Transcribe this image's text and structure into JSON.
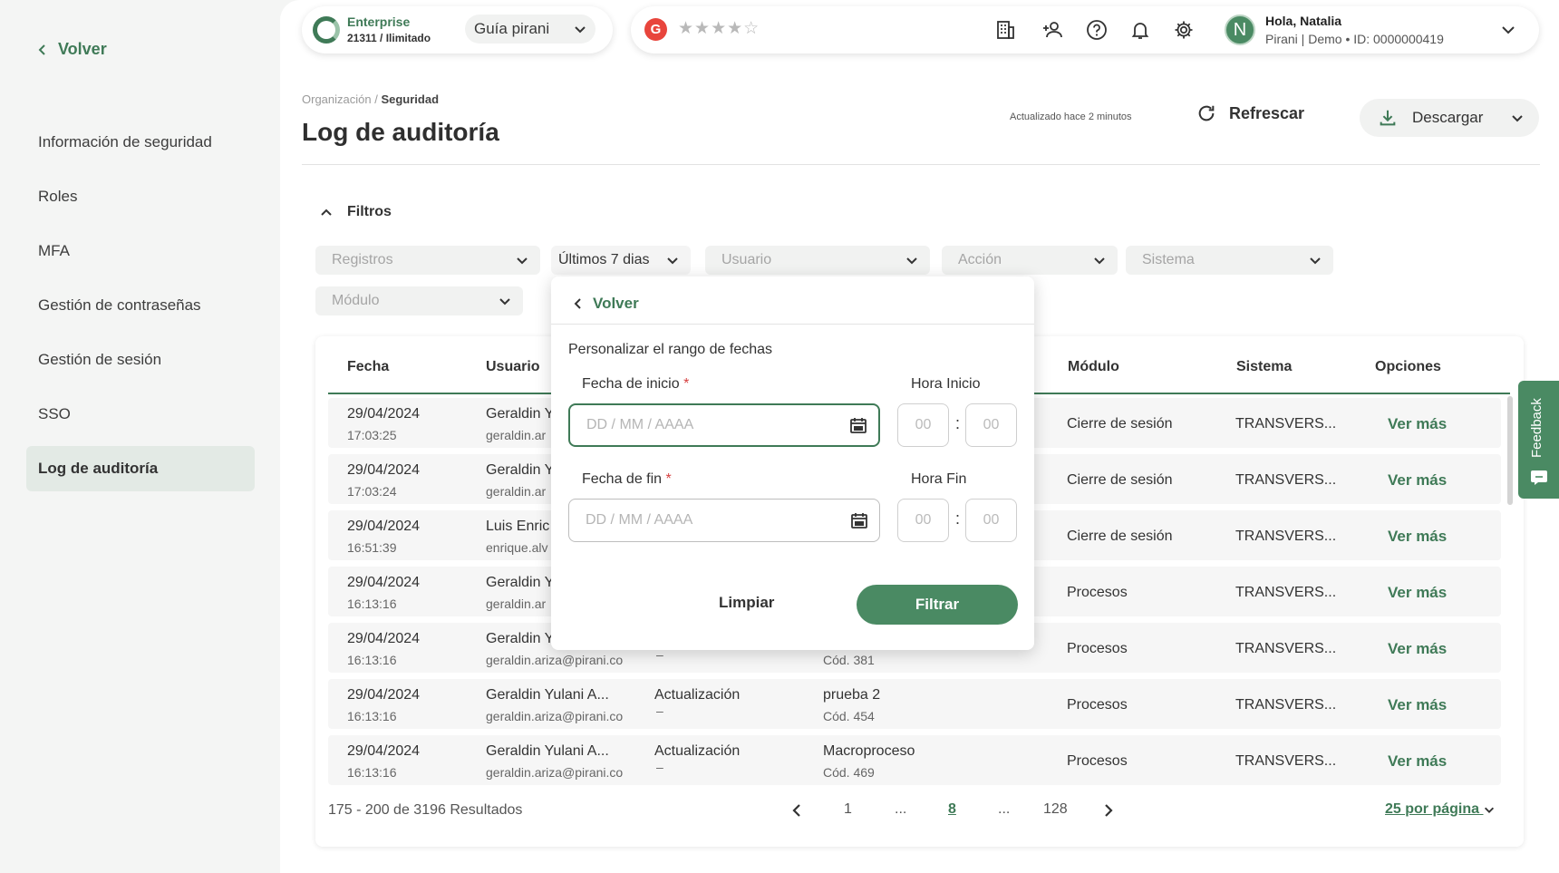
{
  "sidebar": {
    "back_label": "Volver",
    "items": [
      {
        "label": "Información de seguridad"
      },
      {
        "label": "Roles"
      },
      {
        "label": "MFA"
      },
      {
        "label": "Gestión de contraseñas"
      },
      {
        "label": "Gestión de sesión"
      },
      {
        "label": "SSO"
      },
      {
        "label": "Log de auditoría",
        "active": true
      }
    ]
  },
  "topbar": {
    "plan_name": "Enterprise",
    "plan_sub": "21311 / Ilimitado",
    "guide_label": "Guía pirani",
    "g_letter": "G",
    "stars": "★★★★☆",
    "user_hello": "Hola, Natalia",
    "user_sub": "Pirani | Demo • ID: 0000000419",
    "avatar_letter": "N",
    "icons": [
      "building-icon",
      "add-user-icon",
      "help-icon",
      "bell-icon",
      "gear-icon",
      "chevron-down-icon"
    ]
  },
  "header": {
    "breadcrumb_parent": "Organización /",
    "breadcrumb_current": "Seguridad",
    "title": "Log de auditoría",
    "updated": "Actualizado hace 2 minutos",
    "refresh_label": "Refrescar",
    "download_label": "Descargar"
  },
  "filters": {
    "toggle_label": "Filtros",
    "registros": "Registros",
    "period": "Últimos 7 dias",
    "usuario": "Usuario",
    "accion": "Acción",
    "sistema": "Sistema",
    "modulo": "Módulo"
  },
  "table": {
    "headers": {
      "fecha": "Fecha",
      "usuario": "Usuario",
      "modulo": "Módulo",
      "sistema": "Sistema",
      "opciones": "Opciones"
    },
    "rows": [
      {
        "date": "29/04/2024",
        "time": "17:03:25",
        "user": "Geraldin Y",
        "email": "geraldin.ar",
        "action": "",
        "action_sub": "",
        "object": "",
        "object_sub": "",
        "module": "Cierre de sesión",
        "system": "TRANSVERS...",
        "link": "Ver más"
      },
      {
        "date": "29/04/2024",
        "time": "17:03:24",
        "user": "Geraldin Y",
        "email": "geraldin.ar",
        "action": "",
        "action_sub": "",
        "object": "",
        "object_sub": "",
        "module": "Cierre de sesión",
        "system": "TRANSVERS...",
        "link": "Ver más"
      },
      {
        "date": "29/04/2024",
        "time": "16:51:39",
        "user": "Luis Enric",
        "email": "enrique.alv",
        "action": "",
        "action_sub": "",
        "object": "",
        "object_sub": "",
        "module": "Cierre de sesión",
        "system": "TRANSVERS...",
        "link": "Ver más"
      },
      {
        "date": "29/04/2024",
        "time": "16:13:16",
        "user": "Geraldin Y",
        "email": "geraldin.ar",
        "action": "",
        "action_sub": "",
        "object": "",
        "object_sub": "",
        "module": "Procesos",
        "system": "TRANSVERS...",
        "link": "Ver más"
      },
      {
        "date": "29/04/2024",
        "time": "16:13:16",
        "user": "Geraldin Y",
        "email": "geraldin.ariza@pirani.co",
        "action": "",
        "action_sub": "–",
        "object": "",
        "object_sub": "Cód. 381",
        "module": "Procesos",
        "system": "TRANSVERS...",
        "link": "Ver más"
      },
      {
        "date": "29/04/2024",
        "time": "16:13:16",
        "user": "Geraldin Yulani A...",
        "email": "geraldin.ariza@pirani.co",
        "action": "Actualización",
        "action_sub": "–",
        "object": "prueba 2",
        "object_sub": "Cód. 454",
        "module": "Procesos",
        "system": "TRANSVERS...",
        "link": "Ver más"
      },
      {
        "date": "29/04/2024",
        "time": "16:13:16",
        "user": "Geraldin Yulani A...",
        "email": "geraldin.ariza@pirani.co",
        "action": "Actualización",
        "action_sub": "–",
        "object": "Macroproceso",
        "object_sub": "Cód. 469",
        "module": "Procesos",
        "system": "TRANSVERS...",
        "link": "Ver más"
      }
    ]
  },
  "pagination": {
    "results": "175 - 200 de 3196 Resultados",
    "pages": [
      "1",
      "...",
      "8",
      "...",
      "128"
    ],
    "current": "8",
    "per_page": "25 por página"
  },
  "feedback_label": "Feedback",
  "date_popover": {
    "back_label": "Volver",
    "title": "Personalizar el rango de fechas",
    "start_label": "Fecha de inicio",
    "end_label": "Fecha de fin",
    "required_mark": "*",
    "start_time_label": "Hora Inicio",
    "end_time_label": "Hora Fin",
    "date_placeholder": "DD / MM / AAAA",
    "time_placeholder": "00",
    "colon": ":",
    "clear_label": "Limpiar",
    "filter_label": "Filtrar"
  },
  "colors": {
    "accent": "#3f7a57",
    "accent_button": "#4a8a63",
    "required": "#d64040"
  }
}
